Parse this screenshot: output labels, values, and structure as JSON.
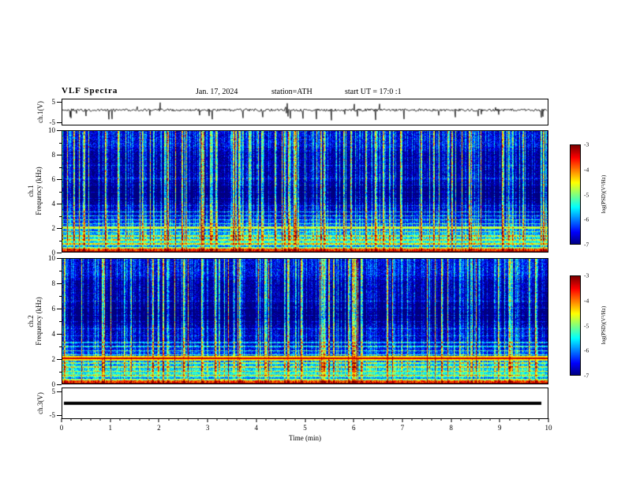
{
  "header": {
    "title": "VLF Spectra",
    "date": "Jan. 17, 2024",
    "station": "station=ATH",
    "start_ut": "start UT =  17:0 :1"
  },
  "panels": {
    "ch1_wave": {
      "label": "ch.1(V)",
      "yticks": [
        "5",
        "-5"
      ]
    },
    "ch1_spec": {
      "label_ch": "ch.1",
      "label_axis": "Frequency (kHz)",
      "yticks": [
        "10",
        "8",
        "6",
        "4",
        "2",
        "0"
      ]
    },
    "ch2_spec": {
      "label_ch": "ch.2",
      "label_axis": "Frequency (kHz)",
      "yticks": [
        "10",
        "8",
        "6",
        "4",
        "2",
        "0"
      ]
    },
    "ch3_wave": {
      "label": "ch.3(V)",
      "yticks": [
        "5",
        "-5"
      ]
    }
  },
  "xaxis": {
    "label": "Time (min)",
    "ticks": [
      "0",
      "1",
      "2",
      "3",
      "4",
      "5",
      "6",
      "7",
      "8",
      "9",
      "10"
    ]
  },
  "colorbar": {
    "label": "log(PSD)(V²/Hz)",
    "ticks": [
      "-3",
      "-4",
      "-5",
      "-6",
      "-7"
    ]
  },
  "chart_data": [
    {
      "type": "line",
      "id": "ch1_waveform",
      "title": "ch.1(V)",
      "xlabel": "Time (min)",
      "xlim": [
        0,
        10
      ],
      "ylim": [
        -5,
        5
      ],
      "yticks": [
        5,
        -5
      ],
      "series": [
        {
          "name": "ch.1 voltage",
          "summary": "continuous broadband noise around ~0.3 V baseline with dense impulsive sferic spikes, most extending down toward -5 V and several upward toward +4 V, roughly uniform over the 10 minutes"
        }
      ]
    },
    {
      "type": "heatmap",
      "id": "ch1_spectrogram",
      "title": "ch.1 Frequency (kHz)",
      "xlabel": "Time (min)",
      "ylabel": "Frequency (kHz)",
      "xlim": [
        0,
        10
      ],
      "ylim": [
        0,
        10
      ],
      "yticks": [
        0,
        2,
        4,
        6,
        8,
        10
      ],
      "color_scale": {
        "label": "log(PSD)(V²/Hz)",
        "min": -7,
        "max": -3,
        "colormap": "jet",
        "ticks": [
          -3,
          -4,
          -5,
          -6,
          -7
        ]
      },
      "dark_band_khz": [
        3.7,
        6.1
      ],
      "narrowband_lines": [
        {
          "khz": 2.0,
          "strength": "moderate"
        }
      ],
      "features": [
        "dense vertical broadband sferic stripes (green to yellow/red) spanning 0-10 kHz for the full 10 minutes",
        "enhanced power below ~3 kHz with many thin horizontal harmonic lines (green/yellow)",
        "bright red/orange base band below ~0.3 kHz",
        "dark navy band between ~3.7 and ~6.1 kHz",
        "speckled green noise near the 9-10 kHz top edge"
      ]
    },
    {
      "type": "heatmap",
      "id": "ch2_spectrogram",
      "title": "ch.2 Frequency (kHz)",
      "xlabel": "Time (min)",
      "ylabel": "Frequency (kHz)",
      "xlim": [
        0,
        10
      ],
      "ylim": [
        0,
        10
      ],
      "yticks": [
        0,
        2,
        4,
        6,
        8,
        10
      ],
      "color_scale": {
        "label": "log(PSD)(V²/Hz)",
        "min": -7,
        "max": -3,
        "colormap": "jet",
        "ticks": [
          -3,
          -4,
          -5,
          -6,
          -7
        ]
      },
      "dark_band_khz": [
        4.4,
        6.6
      ],
      "narrowband_lines": [
        {
          "khz": 2.02,
          "strength": "strong"
        }
      ],
      "features": [
        "dense vertical broadband sferic stripes spanning 0-10 kHz for the full 10 minutes",
        "strong continuous narrowband emission line at ~2 kHz (red/yellow, log PSD near -3)",
        "enhanced power with horizontal harmonic lines below ~3 kHz",
        "bright base band below ~0.3 kHz",
        "dark navy band between ~4.4 and ~6.6 kHz"
      ]
    },
    {
      "type": "line",
      "id": "ch3_waveform",
      "title": "ch.3(V)",
      "xlabel": "Time (min)",
      "xlim": [
        0,
        10
      ],
      "ylim": [
        -5,
        5
      ],
      "yticks": [
        5,
        -5
      ],
      "series": [
        {
          "name": "ch.3 voltage",
          "summary": "flat constant level at ~0 V for the entire interval (thick solid black line, no variation)"
        }
      ]
    }
  ]
}
